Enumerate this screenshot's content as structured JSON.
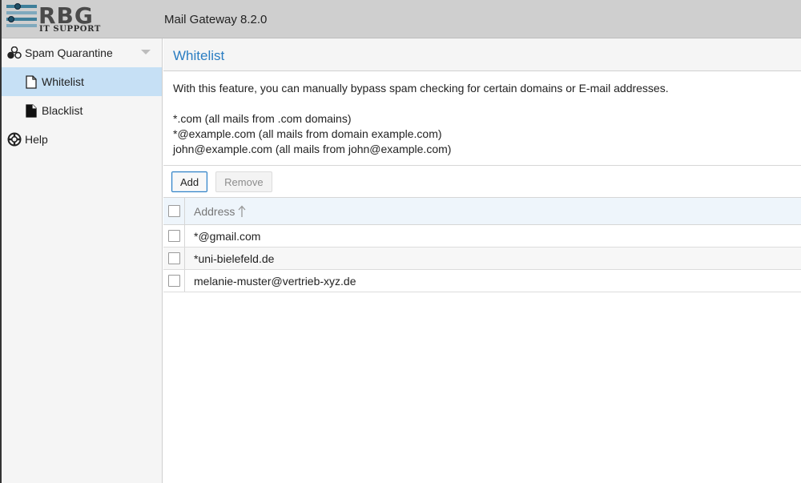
{
  "header": {
    "logo_main": "RBG",
    "logo_sub": "IT SUPPORT",
    "title": "Mail Gateway 8.2.0"
  },
  "sidebar": {
    "items": [
      {
        "label": "Spam Quarantine",
        "icon": "spam-quarantine-icon",
        "level": 0,
        "selected": false,
        "expandable": true
      },
      {
        "label": "Whitelist",
        "icon": "document-outline-icon",
        "level": 1,
        "selected": true
      },
      {
        "label": "Blacklist",
        "icon": "document-filled-icon",
        "level": 1,
        "selected": false
      },
      {
        "label": "Help",
        "icon": "lifebuoy-icon",
        "level": 0,
        "selected": false
      }
    ]
  },
  "panel": {
    "title": "Whitelist",
    "description": "With this feature, you can manually bypass spam checking for certain domains or E-mail addresses.",
    "examples": [
      "*.com (all mails from .com domains)",
      "*@example.com (all mails from domain example.com)",
      "john@example.com (all mails from john@example.com)"
    ]
  },
  "toolbar": {
    "add_label": "Add",
    "remove_label": "Remove"
  },
  "grid": {
    "column_address": "Address",
    "sort": "ascending",
    "rows": [
      {
        "address": "*@gmail.com"
      },
      {
        "address": "*uni-bielefeld.de"
      },
      {
        "address": "melanie-muster@vertrieb-xyz.de"
      }
    ]
  },
  "colors": {
    "accent": "#2a7dc2",
    "selected_bg": "#c6e0f5",
    "header_bg": "#cfcfcf"
  }
}
